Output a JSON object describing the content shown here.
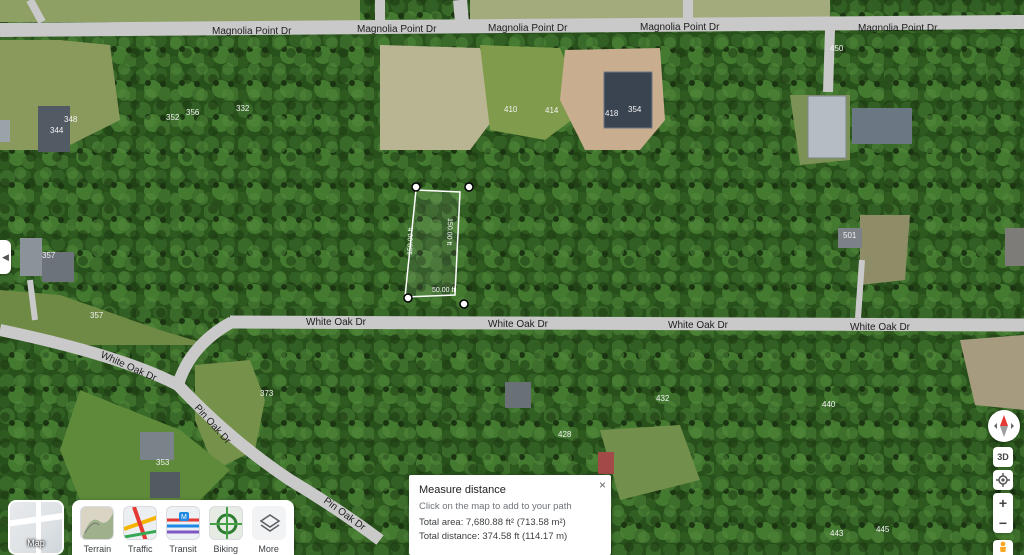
{
  "map": {
    "roads": {
      "magnolia": "Magnolia Point Dr",
      "white_oak": "White Oak Dr",
      "pin_oak": "Pin Oak Dr"
    },
    "addresses": {
      "a356": "356",
      "a352": "352",
      "a348": "348",
      "a344": "344",
      "a410": "410",
      "a414": "414",
      "a418": "418",
      "a354": "354",
      "a450": "450",
      "a501": "501",
      "a357_left": "357",
      "a357": "357",
      "a373": "373",
      "a432": "432",
      "a428": "428",
      "a440": "440",
      "a353": "353",
      "a443": "443",
      "a445": "445",
      "a332": "332"
    },
    "colors": {
      "road": "#c9c9c9",
      "foliage_dark": "#1d3a14",
      "foliage": "#2f5a22",
      "measure_line": "#ffffff"
    }
  },
  "side_toggle": {
    "icon": "triangle-left-icon"
  },
  "layers": {
    "current": {
      "label": "Map"
    },
    "options": [
      {
        "label": "Terrain",
        "icon": "terrain-icon"
      },
      {
        "label": "Traffic",
        "icon": "traffic-icon"
      },
      {
        "label": "Transit",
        "icon": "transit-icon"
      },
      {
        "label": "Biking",
        "icon": "biking-icon"
      },
      {
        "label": "More",
        "icon": "layers-icon"
      }
    ]
  },
  "controls": {
    "three_d": "3D",
    "zoom_in": "+",
    "zoom_out": "−"
  },
  "measure": {
    "title": "Measure distance",
    "hint": "Click on the map to add to your path",
    "area": "Total area: 7,680.88 ft² (713.58 m²)",
    "distance": "Total distance: 374.58 ft (114.17 m)",
    "close": "×"
  },
  "measure_labels": {
    "left_side": "150.00 ft",
    "right_side": "150.00 ft",
    "bottom_side": "50.00 ft"
  }
}
